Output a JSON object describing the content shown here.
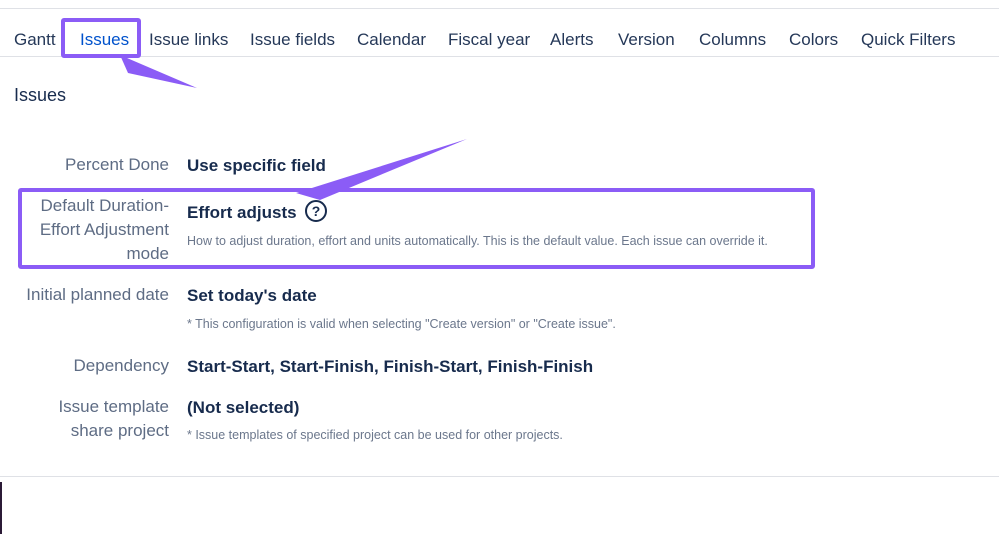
{
  "tabs": [
    {
      "label": "Gantt"
    },
    {
      "label": "Issues",
      "active": true
    },
    {
      "label": "Issue links"
    },
    {
      "label": "Issue fields"
    },
    {
      "label": "Calendar"
    },
    {
      "label": "Fiscal year"
    },
    {
      "label": "Alerts"
    },
    {
      "label": "Version"
    },
    {
      "label": "Columns"
    },
    {
      "label": "Colors"
    },
    {
      "label": "Quick Filters"
    }
  ],
  "section": {
    "title": "Issues"
  },
  "settings": {
    "percent_done": {
      "label": "Percent Done",
      "value": "Use specific field"
    },
    "default_duration": {
      "label_lines": [
        "Default Duration-",
        "Effort Adjustment",
        "mode"
      ],
      "value": "Effort adjusts",
      "help": "?",
      "hint": "How to adjust duration, effort and units automatically. This is the default value. Each issue can override it."
    },
    "initial_planned_date": {
      "label": "Initial planned date",
      "value": "Set today's date",
      "hint": "* This configuration is valid when selecting \"Create version\" or \"Create issue\"."
    },
    "dependency": {
      "label": "Dependency",
      "value": "Start-Start, Start-Finish, Finish-Start, Finish-Finish"
    },
    "issue_template": {
      "label_lines": [
        "Issue template",
        "share project"
      ],
      "value": "(Not selected)",
      "hint": "* Issue templates of specified project can be used for other projects."
    }
  },
  "colors": {
    "annotation": "#8b5cf6",
    "active_tab": "#0052cc",
    "label": "#5e6c84"
  }
}
